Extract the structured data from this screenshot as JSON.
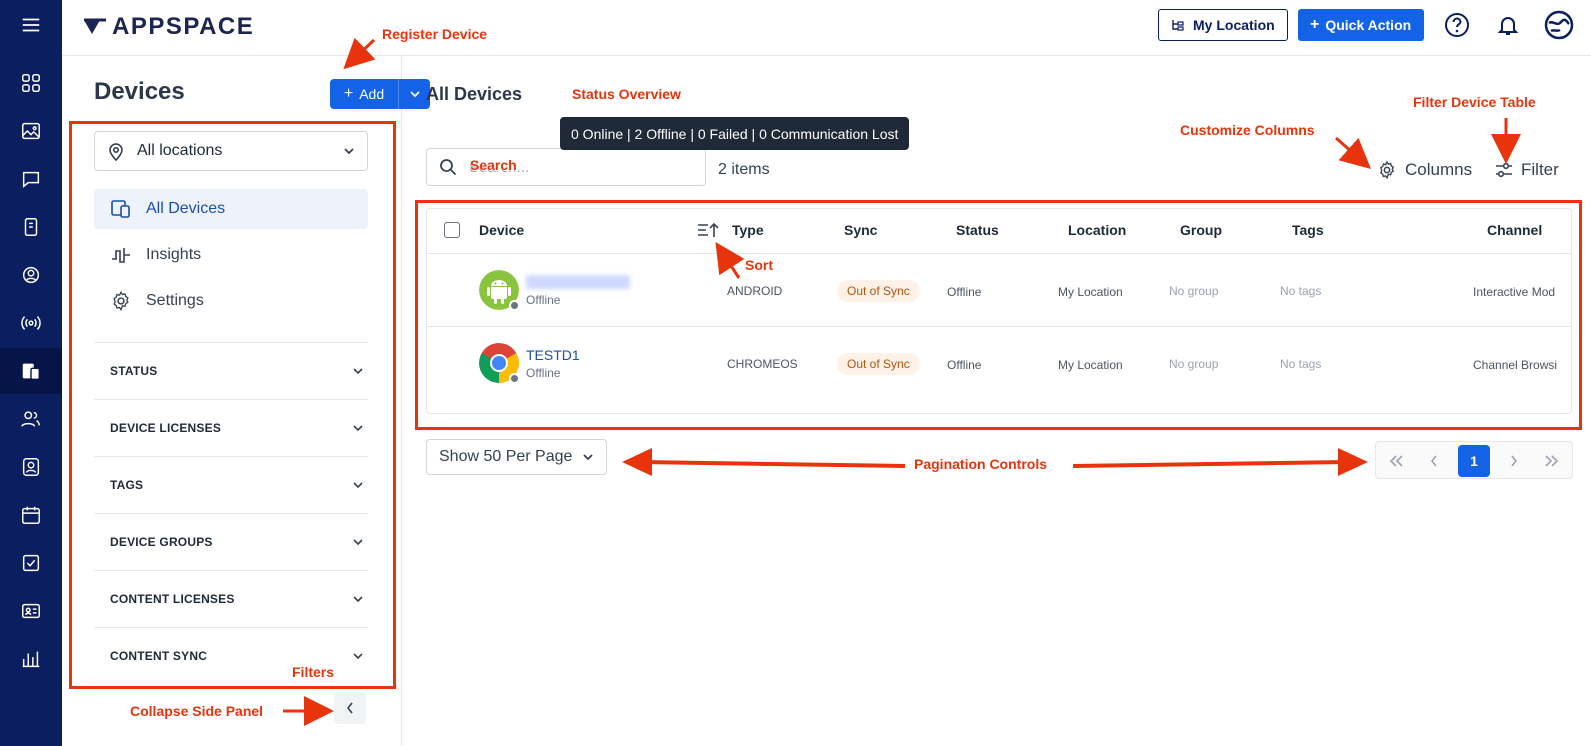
{
  "header": {
    "logo_text": "APPSPACE",
    "my_location_label": "My Location",
    "quick_action_label": "Quick Action"
  },
  "rail": {
    "items": [
      "menu-icon",
      "dashboard-icon",
      "image-icon",
      "chat-icon",
      "device-icon",
      "target-icon",
      "broadcast-icon",
      "devices-icon",
      "users-icon",
      "user-icon",
      "calendar-icon",
      "task-icon",
      "id-card-icon",
      "bar-chart-icon"
    ]
  },
  "side": {
    "title": "Devices",
    "add_label": "Add",
    "location_select": "All locations",
    "nav": [
      {
        "label": "All Devices"
      },
      {
        "label": "Insights"
      },
      {
        "label": "Settings"
      }
    ],
    "filters": [
      "STATUS",
      "DEVICE LICENSES",
      "TAGS",
      "DEVICE GROUPS",
      "CONTENT LICENSES",
      "CONTENT SYNC"
    ]
  },
  "main": {
    "title": "All Devices",
    "status_tooltip": "0 Online | 2 Offline | 0 Failed | 0 Communication Lost",
    "search_placeholder": "Search...",
    "items_count": "2 items",
    "columns_label": "Columns",
    "filter_label": "Filter",
    "table": {
      "headers": [
        "Device",
        "Type",
        "Sync",
        "Status",
        "Location",
        "Group",
        "Tags",
        "Channel"
      ],
      "rows": [
        {
          "name": "",
          "sub": "Offline",
          "type": "ANDROID",
          "sync": "Out of Sync",
          "status": "Offline",
          "location": "My Location",
          "group": "No group",
          "tags": "No tags",
          "channel": "Interactive Mod"
        },
        {
          "name": "TESTD1",
          "sub": "Offline",
          "type": "CHROMEOS",
          "sync": "Out of Sync",
          "status": "Offline",
          "location": "My Location",
          "group": "No group",
          "tags": "No tags",
          "channel": "Channel Browsi"
        }
      ]
    },
    "per_page_label": "Show 50 Per Page",
    "current_page": "1"
  },
  "annotations": {
    "register_device": "Register Device",
    "status_overview": "Status Overview",
    "search": "Search",
    "customize_columns": "Customize Columns",
    "filter_device_table": "Filter Device Table",
    "sort": "Sort",
    "pagination_controls": "Pagination Controls",
    "filters": "Filters",
    "collapse_side_panel": "Collapse Side Panel"
  },
  "colors": {
    "rail": "#0b1e60",
    "primary": "#1463e6",
    "annotation": "#e8340c",
    "sync_badge_bg": "#fdf1e8",
    "sync_badge_text": "#b45309"
  }
}
